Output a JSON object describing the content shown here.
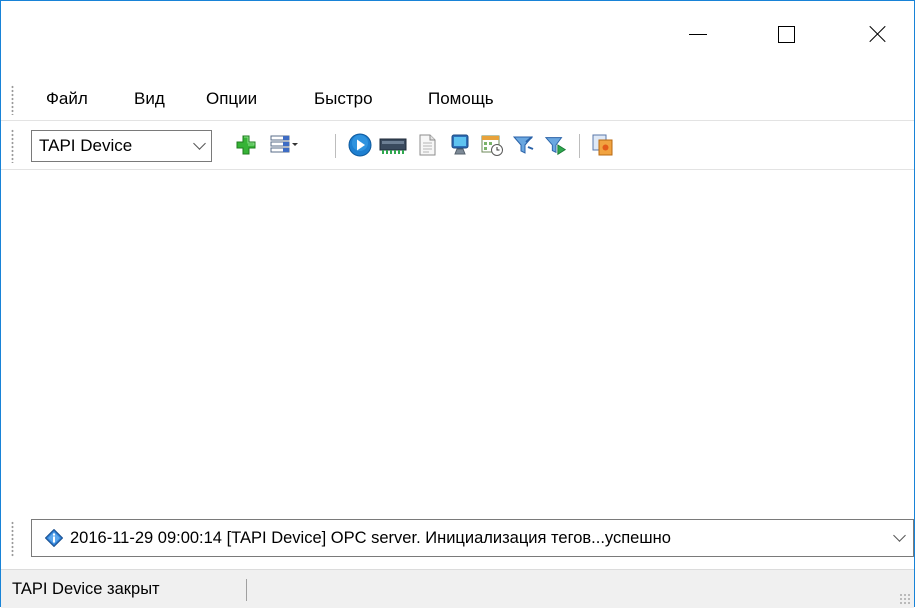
{
  "window": {
    "minimize_icon": "minimize-icon",
    "maximize_icon": "maximize-icon",
    "close_icon": "close-icon"
  },
  "menu": {
    "items": [
      "Файл",
      "Вид",
      "Опции",
      "Быстро",
      "Помощь"
    ]
  },
  "toolbar": {
    "device_select_value": "TAPI Device",
    "buttons": [
      "add-icon",
      "list-view-icon",
      "start-icon",
      "device-icon",
      "document-icon",
      "monitor-icon",
      "schedule-icon",
      "filter-icon",
      "filter-apply-icon",
      "export-icon"
    ]
  },
  "log": {
    "selected_entry": "2016-11-29 09:00:14 [TAPI Device] OPC server. Инициализация тегов...успешно",
    "entry_icon": "info-icon"
  },
  "status": {
    "text": "TAPI Device закрыт"
  },
  "colors": {
    "window_border": "#1883d7",
    "status_bg": "#f0f0f0"
  }
}
